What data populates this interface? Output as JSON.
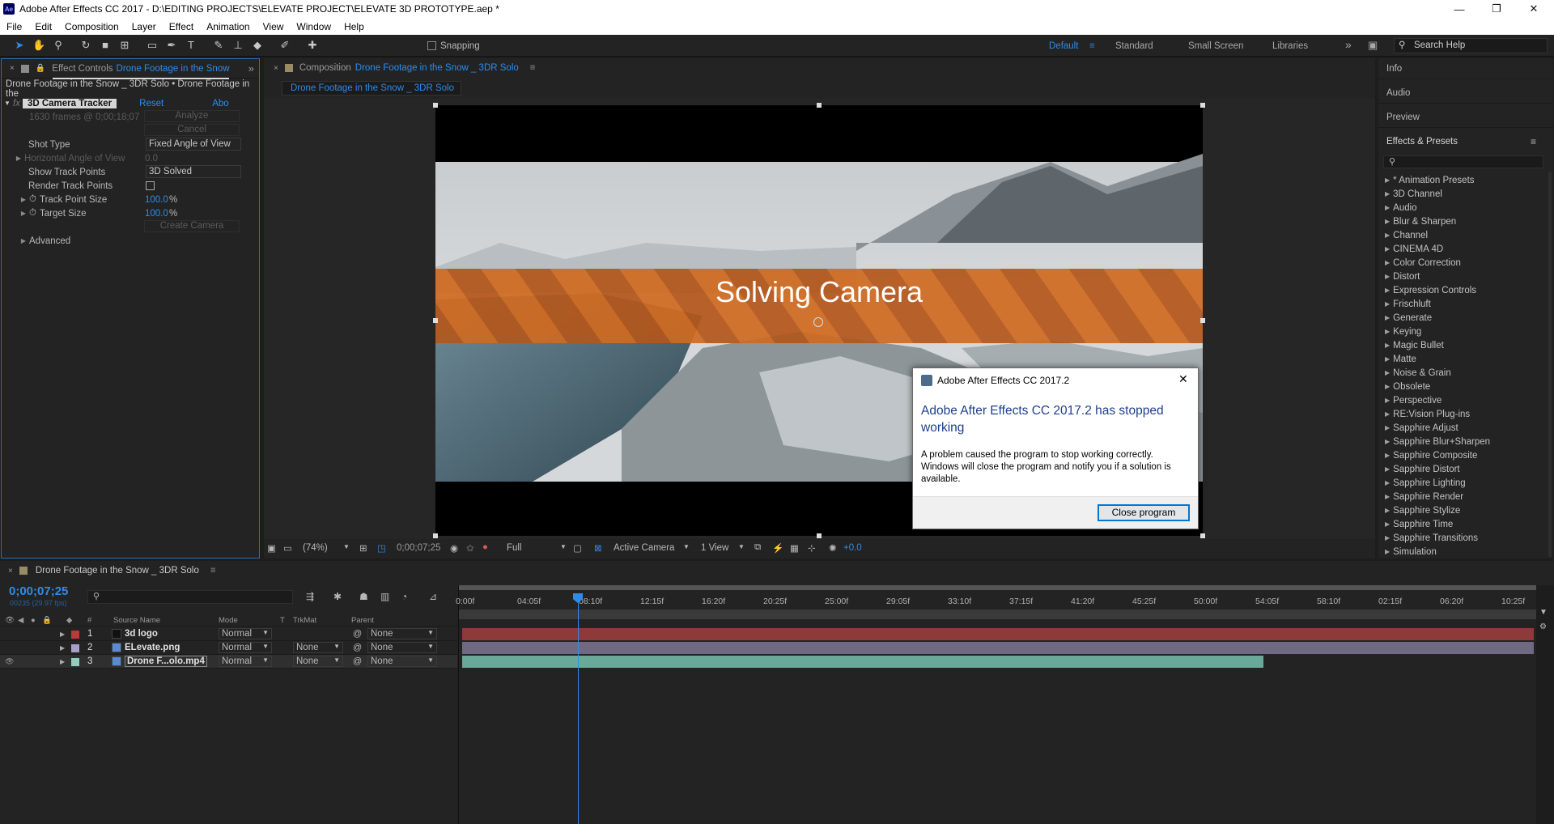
{
  "window": {
    "title": "Adobe After Effects CC 2017 - D:\\EDITING PROJECTS\\ELEVATE PROJECT\\ELEVATE 3D PROTOTYPE.aep *",
    "logo": "Ae",
    "min": "—",
    "max": "❐",
    "close": "✕"
  },
  "menu": [
    "File",
    "Edit",
    "Composition",
    "Layer",
    "Effect",
    "Animation",
    "View",
    "Window",
    "Help"
  ],
  "toolbar": {
    "snapping": "Snapping",
    "workspaces": [
      "Default",
      "Standard",
      "Small Screen",
      "Libraries"
    ],
    "more": "»",
    "search_placeholder": "Search Help"
  },
  "effect_controls": {
    "tab_label": "Effect Controls",
    "tab_target": "Drone Footage in the Snow",
    "breadcrumb": "Drone Footage in the Snow _ 3DR Solo • Drone Footage in the",
    "effect_name": "3D Camera Tracker",
    "reset": "Reset",
    "about": "Abo",
    "frames_info": "1630 frames @ 0;00;18;07",
    "analyze": "Analyze",
    "cancel": "Cancel",
    "shot_type_label": "Shot Type",
    "shot_type_value": "Fixed Angle of View",
    "hfov_label": "Horizontal Angle of View",
    "hfov_value": "0.0",
    "show_track_points_label": "Show Track Points",
    "show_track_points_value": "3D Solved",
    "render_track_points_label": "Render Track Points",
    "track_point_size_label": "Track Point Size",
    "track_point_size_value": "100.0",
    "target_size_label": "Target Size",
    "target_size_value": "100.0",
    "percent": "%",
    "create_camera": "Create Camera",
    "advanced": "Advanced"
  },
  "composition": {
    "tab_label": "Composition",
    "tab_name": "Drone Footage in the Snow _ 3DR Solo",
    "subtab": "Drone Footage in the Snow _ 3DR Solo",
    "overlay_text": "Solving Camera",
    "zoom": "(74%)",
    "timecode": "0;00;07;25",
    "resolution": "Full",
    "camera": "Active Camera",
    "views": "1 View",
    "exposure": "+0.0"
  },
  "dialog": {
    "title": "Adobe After Effects CC 2017.2",
    "heading": "Adobe After Effects CC 2017.2 has stopped working",
    "body": "A problem caused the program to stop working correctly. Windows will close the program and notify you if a solution is available.",
    "button": "Close program",
    "close": "✕"
  },
  "right_panels": {
    "info": "Info",
    "audio": "Audio",
    "preview": "Preview",
    "effects_presets": "Effects & Presets",
    "items": [
      "* Animation Presets",
      "3D Channel",
      "Audio",
      "Blur & Sharpen",
      "Channel",
      "CINEMA 4D",
      "Color Correction",
      "Distort",
      "Expression Controls",
      "Frischluft",
      "Generate",
      "Keying",
      "Magic Bullet",
      "Matte",
      "Noise & Grain",
      "Obsolete",
      "Perspective",
      "RE:Vision Plug-ins",
      "Sapphire Adjust",
      "Sapphire Blur+Sharpen",
      "Sapphire Composite",
      "Sapphire Distort",
      "Sapphire Lighting",
      "Sapphire Render",
      "Sapphire Stylize",
      "Sapphire Time",
      "Sapphire Transitions",
      "Simulation"
    ]
  },
  "timeline": {
    "tab": "Drone Footage in the Snow _ 3DR Solo",
    "timecode": "0;00;07;25",
    "fps": "00235 (29.97 fps)",
    "headers": {
      "num": "#",
      "source": "Source Name",
      "mode": "Mode",
      "t": "T",
      "trkmat": "TrkMat",
      "parent": "Parent"
    },
    "layers": [
      {
        "num": "1",
        "name": "3d logo",
        "mode": "Normal",
        "trkmat": "",
        "parent": "None",
        "color": "#b93a3a"
      },
      {
        "num": "2",
        "name": "ELevate.png",
        "mode": "Normal",
        "trkmat": "None",
        "parent": "None",
        "color": "#a89ec9"
      },
      {
        "num": "3",
        "name": "Drone F...olo.mp4",
        "mode": "Normal",
        "trkmat": "None",
        "parent": "None",
        "color": "#8fcfbe"
      }
    ],
    "ruler": [
      "0:00f",
      "04:05f",
      "08:10f",
      "12:15f",
      "16:20f",
      "20:25f",
      "25:00f",
      "29:05f",
      "33:10f",
      "37:15f",
      "41:20f",
      "45:25f",
      "50:00f",
      "54:05f",
      "58:10f",
      "02:15f",
      "06:20f",
      "10:25f"
    ]
  },
  "colors": {
    "accent": "#2d8ceb",
    "orange_band": "#c8621a",
    "layer1_bar": "#8f3a3a",
    "layer2_bar": "#6f6a82",
    "layer3_bar": "#6aa89a"
  }
}
